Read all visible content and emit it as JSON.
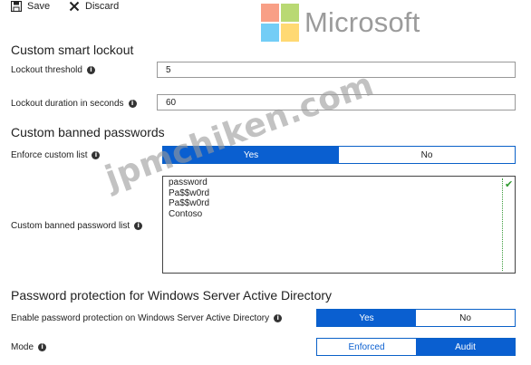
{
  "toolbar": {
    "save_label": "Save",
    "discard_label": "Discard"
  },
  "logo": {
    "text": "Microsoft",
    "colors": [
      "#f25022",
      "#7fba00",
      "#00a4ef",
      "#ffb900"
    ]
  },
  "lockout": {
    "heading": "Custom smart lockout",
    "threshold_label": "Lockout threshold",
    "threshold_value": "5",
    "duration_label": "Lockout duration in seconds",
    "duration_value": "60"
  },
  "banned": {
    "heading": "Custom banned passwords",
    "enforce_label": "Enforce custom list",
    "enforce_options": {
      "yes": "Yes",
      "no": "No"
    },
    "enforce_selected": "Yes",
    "list_label": "Custom banned password list",
    "list_entries": [
      "password",
      "Pa$$w0rd",
      "Pa$$w0rd",
      "Contoso"
    ]
  },
  "protection": {
    "heading": "Password protection for Windows Server Active Directory",
    "enable_label": "Enable password protection on Windows Server Active Directory",
    "enable_options": {
      "yes": "Yes",
      "no": "No"
    },
    "enable_selected": "Yes",
    "mode_label": "Mode",
    "mode_options": {
      "enforced": "Enforced",
      "audit": "Audit"
    },
    "mode_selected": "Audit"
  },
  "watermark": "jpmchiken.com",
  "accent_color": "#0a5fd0"
}
